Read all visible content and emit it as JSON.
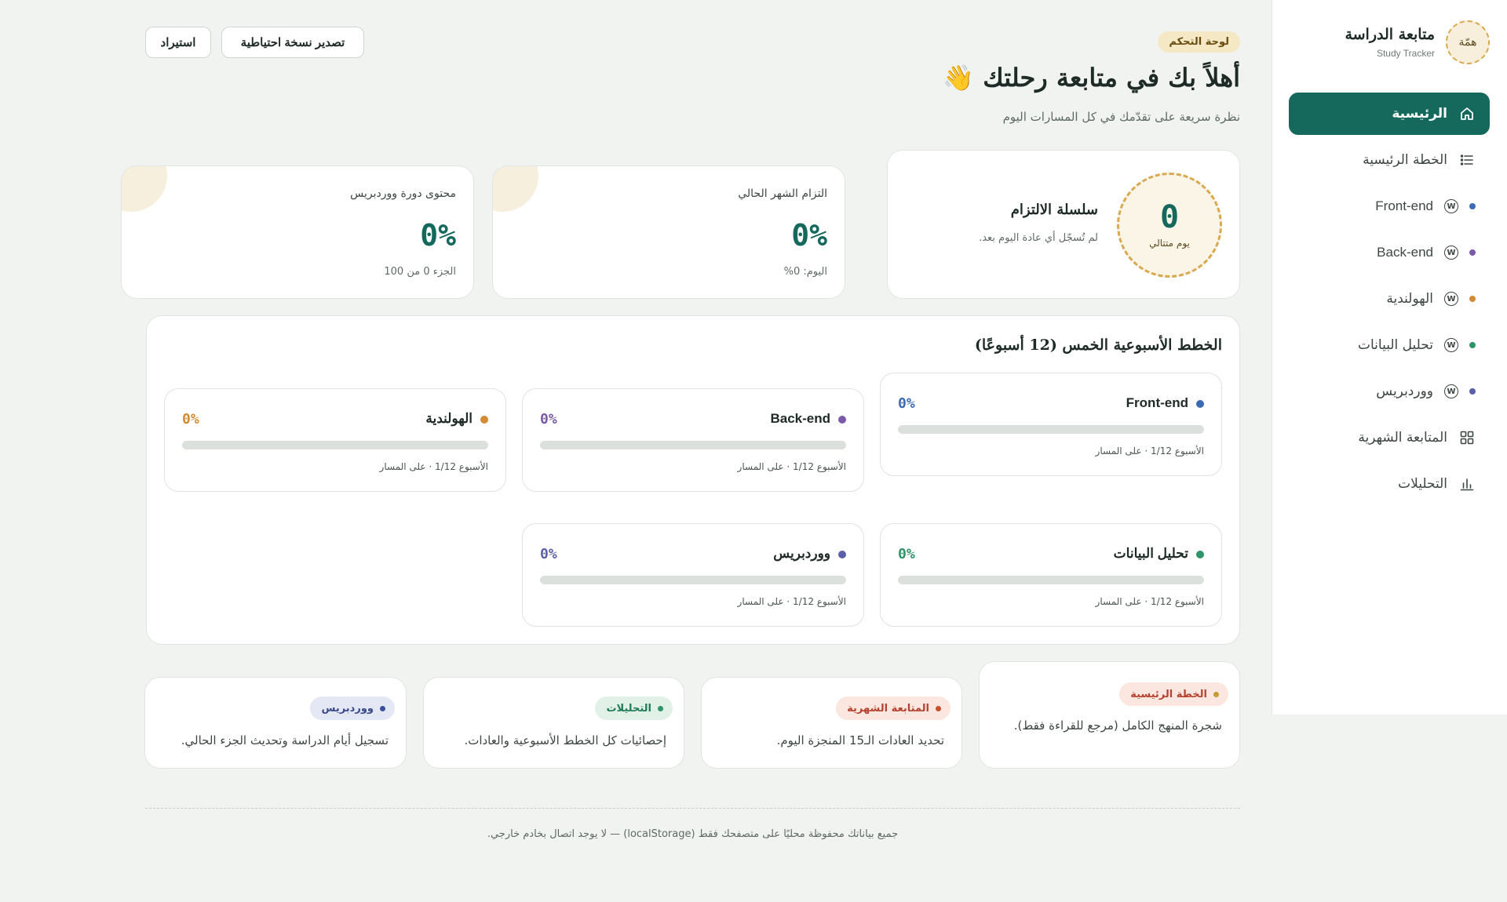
{
  "brand": {
    "logo": "همّة",
    "title": "متابعة الدراسة",
    "subtitle": "Study Tracker"
  },
  "nav": {
    "home": "الرئيسية",
    "main_plan": "الخطة الرئيسية",
    "frontend": "Front-end",
    "backend": "Back-end",
    "dutch": "الهولندية",
    "data": "تحليل البيانات",
    "wordpress": "ووردبريس",
    "monthly": "المتابعة الشهرية",
    "analytics": "التحليلات"
  },
  "header": {
    "badge": "لوحة التحكم",
    "title": "أهلاً بك في متابعة رحلتك 👋",
    "subtitle": "نظرة سريعة على تقدّمك في كل المسارات اليوم",
    "export_label": "تصدير نسخة احتياطية",
    "import_label": "استيراد"
  },
  "streak": {
    "value": "0",
    "unit": "يوم متتالي",
    "title": "سلسلة الالتزام",
    "desc": "لم تُسجّل أي عادة اليوم بعد."
  },
  "month": {
    "label": "التزام الشهر الحالي",
    "value": "0%",
    "foot": "اليوم: 0%"
  },
  "wp_content": {
    "label": "محتوى دورة ووردبريس",
    "value": "0%",
    "foot": "الجزء 0 من 100"
  },
  "plans": {
    "title": "الخطط الأسبوعية الخمس (12 أسبوعًا)",
    "tracks": [
      {
        "name": "Front-end",
        "pct": "0%",
        "progress": 0,
        "meta": "الأسبوع 1/12 · على المسار",
        "color": "#3d6bb3"
      },
      {
        "name": "Back-end",
        "pct": "0%",
        "progress": 0,
        "meta": "الأسبوع 1/12 · على المسار",
        "color": "#7a5aa8"
      },
      {
        "name": "الهولندية",
        "pct": "0%",
        "progress": 0,
        "meta": "الأسبوع 1/12 · على المسار",
        "color": "#d48a34"
      },
      {
        "name": "تحليل البيانات",
        "pct": "0%",
        "progress": 0,
        "meta": "الأسبوع 1/12 · على المسار",
        "color": "#2f9467"
      },
      {
        "name": "ووردبريس",
        "pct": "0%",
        "progress": 0,
        "meta": "الأسبوع 1/12 · على المسار",
        "color": "#5a5fa8"
      }
    ]
  },
  "links": [
    {
      "tag": "الخطة الرئيسية",
      "desc": "شجرة المنهج الكامل (مرجع للقراءة فقط).",
      "tag_bg": "#fbe6e0",
      "tag_color": "#b4432f",
      "dot": "#c79a2e"
    },
    {
      "tag": "المتابعة الشهرية",
      "desc": "تحديد العادات الـ15 المنجزة اليوم.",
      "tag_bg": "#fbe6e0",
      "tag_color": "#b4432f",
      "dot": "#c8502f"
    },
    {
      "tag": "التحليلات",
      "desc": "إحصائيات كل الخطط الأسبوعية والعادات.",
      "tag_bg": "#e2f1e8",
      "tag_color": "#1f7a55",
      "dot": "#2f9467"
    },
    {
      "tag": "ووردبريس",
      "desc": "تسجيل أيام الدراسة وتحديث الجزء الحالي.",
      "tag_bg": "#e4e8f4",
      "tag_color": "#3b4a8a",
      "dot": "#3d4fa0"
    }
  ],
  "footer": "جميع بياناتك محفوظة محليًا على متصفحك فقط (localStorage) — لا يوجد اتصال بخادم خارجي."
}
